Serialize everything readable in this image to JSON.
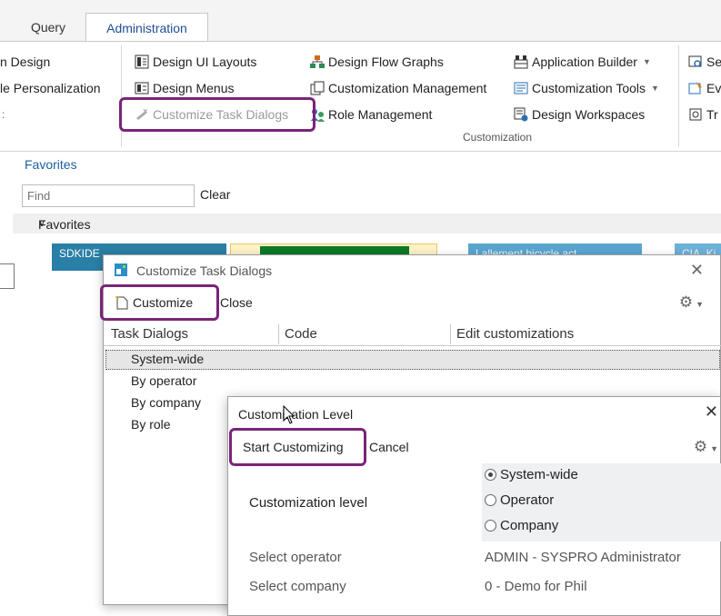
{
  "tabs": {
    "query": "Query",
    "administration": "Administration"
  },
  "ribbon": {
    "col1": {
      "design": "n Design",
      "personalization": "le Personalization",
      "more": ":"
    },
    "col2": {
      "design_ui_layouts": "Design UI Layouts",
      "design_menus": "Design Menus",
      "customize_task_dialogs": "Customize Task Dialogs"
    },
    "col3": {
      "design_flow_graphs": "Design Flow Graphs",
      "customization_management": "Customization Management",
      "role_management": "Role Management"
    },
    "col4": {
      "application_builder": "Application Builder",
      "customization_tools": "Customization Tools",
      "design_workspaces": "Design Workspaces"
    },
    "col5": {
      "se": "Se",
      "ev": "Ev",
      "tr": "Tr"
    },
    "group_label": "Customization"
  },
  "favorites": {
    "title": "Favorites",
    "find_placeholder": "Find",
    "clear": "Clear",
    "section": "Favorites",
    "tiles": [
      "SDKIDE",
      "",
      "Lallement bicycle act...",
      "CIA_Ki..."
    ]
  },
  "dialog_task": {
    "title": "Customize Task Dialogs",
    "customize": "Customize",
    "close": "Close",
    "columns": [
      "Task Dialogs",
      "Code",
      "Edit customizations"
    ],
    "rows": [
      "System-wide",
      "By operator",
      "By company",
      "By role"
    ]
  },
  "dialog_level": {
    "title": "Customization Level",
    "start": "Start Customizing",
    "cancel": "Cancel",
    "level_label": "Customization level",
    "options": [
      "System-wide",
      "Operator",
      "Company"
    ],
    "selected": "System-wide",
    "operator_label": "Select operator",
    "operator_value": "ADMIN -  SYSPRO Administrator",
    "company_label": "Select company",
    "company_value": "0 -  Demo for Phil"
  },
  "colors": {
    "accent": "#1f5fa0",
    "highlight": "#7a2478",
    "tile_blue": "#2a7fa6",
    "tile_green": "#0c7a26"
  }
}
